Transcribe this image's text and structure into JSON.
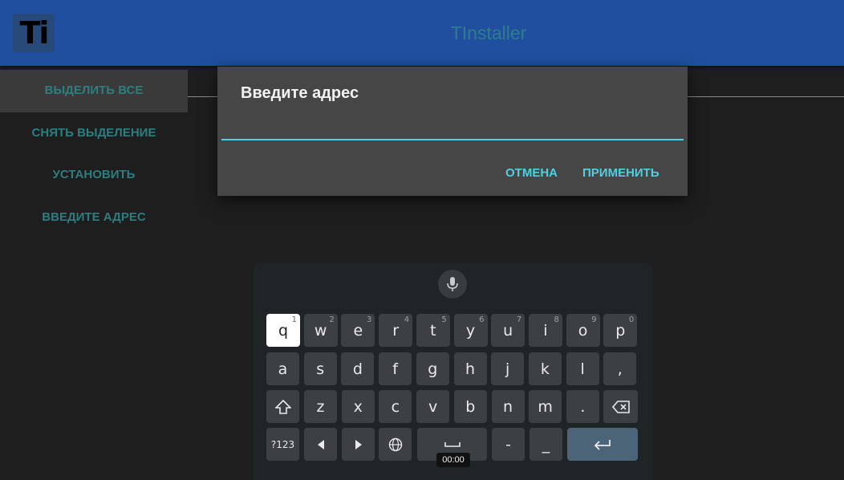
{
  "app": {
    "title": "TInstaller",
    "logo_text": "Ti"
  },
  "sidebar": {
    "items": [
      {
        "label": "ВЫДЕЛИТЬ ВСЕ"
      },
      {
        "label": "СНЯТЬ ВЫДЕЛЕНИЕ"
      },
      {
        "label": "УСТАНОВИТЬ"
      },
      {
        "label": "ВВЕДИТЕ АДРЕС"
      }
    ]
  },
  "dialog": {
    "title": "Введите адрес",
    "input_value": "",
    "cancel_label": "ОТМЕНА",
    "apply_label": "ПРИМЕНИТЬ"
  },
  "keyboard": {
    "mic_icon": "microphone-icon",
    "row1": [
      {
        "label": "q",
        "hint": "1"
      },
      {
        "label": "w",
        "hint": "2"
      },
      {
        "label": "e",
        "hint": "3"
      },
      {
        "label": "r",
        "hint": "4"
      },
      {
        "label": "t",
        "hint": "5"
      },
      {
        "label": "y",
        "hint": "6"
      },
      {
        "label": "u",
        "hint": "7"
      },
      {
        "label": "i",
        "hint": "8"
      },
      {
        "label": "o",
        "hint": "9"
      },
      {
        "label": "p",
        "hint": "0"
      }
    ],
    "row2": [
      "a",
      "s",
      "d",
      "f",
      "g",
      "h",
      "j",
      "k",
      "l",
      ","
    ],
    "row3": [
      "z",
      "x",
      "c",
      "v",
      "b",
      "n",
      "m",
      "."
    ],
    "sym_label": "?123",
    "dash_label": "-",
    "underscore_label": "_",
    "selected_key": "q"
  },
  "status": {
    "timer": "00:00"
  },
  "colors": {
    "appbar": "#1f4f9e",
    "accent": "#4dd0e1",
    "sidebar_text": "#2e7d7f"
  }
}
